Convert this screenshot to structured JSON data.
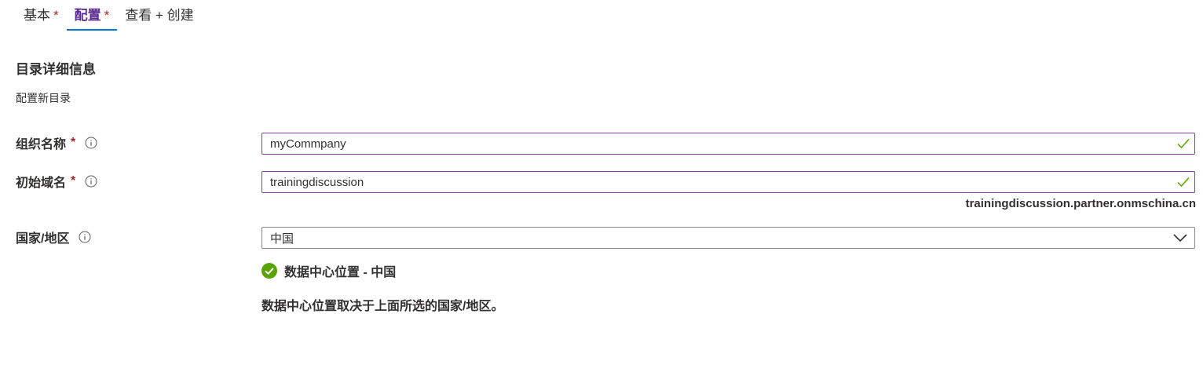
{
  "tabs": [
    {
      "label": "基本",
      "required_mark": "*"
    },
    {
      "label": "配置",
      "required_mark": "*",
      "active": true
    },
    {
      "label": "查看 + 创建"
    }
  ],
  "section": {
    "title": "目录详细信息",
    "subtitle": "配置新目录"
  },
  "fields": {
    "org_name": {
      "label": "组织名称",
      "required_mark": "*",
      "value": "myCommpany",
      "info_icon": "info-icon",
      "status_icon": "checkmark-icon"
    },
    "initial_domain": {
      "label": "初始域名",
      "required_mark": "*",
      "value": "trainingdiscussion",
      "info_icon": "info-icon",
      "status_icon": "checkmark-icon",
      "hint": "trainingdiscussion.partner.onmschina.cn"
    },
    "country": {
      "label": "国家/地区",
      "value": "中国",
      "info_icon": "info-icon",
      "dropdown_icon": "chevron-down-icon"
    }
  },
  "datacenter": {
    "status_icon": "success-check-icon",
    "status_text": "数据中心位置 - 中国",
    "note": "数据中心位置取决于上面所选的国家/地区。"
  },
  "colors": {
    "accent_purple": "#5c2d91",
    "tab_underline": "#0078d4",
    "required_red": "#a4262c",
    "success_green": "#57a300",
    "input_border": "#8a3e9a"
  }
}
